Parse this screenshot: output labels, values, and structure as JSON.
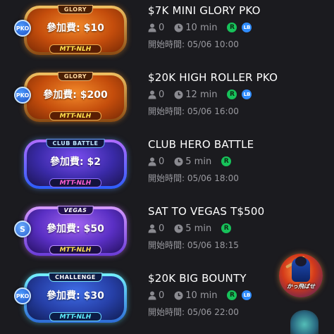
{
  "tournaments": [
    {
      "style": "orange",
      "tag": "GLORY",
      "badge": "PKO",
      "fee": "參加費: $10",
      "game": "MTT-NLH",
      "title": "$7K MINI GLORY PKO",
      "players": "0",
      "duration": "10 min",
      "chips": [
        "R",
        "LB"
      ],
      "start": "開始時間: 05/06 10:00"
    },
    {
      "style": "orange",
      "tag": "GLORY",
      "badge": "PKO",
      "fee": "參加費: $200",
      "game": "MTT-NLH",
      "title": "$20K HIGH ROLLER PKO",
      "players": "0",
      "duration": "12 min",
      "chips": [
        "R",
        "LB"
      ],
      "start": "開始時間: 05/06 16:00"
    },
    {
      "style": "blue",
      "tag": "CLUB BATTLE",
      "badge": "",
      "fee": "參加費: $2",
      "game": "MTT-NLH",
      "title": "CLUB HERO BATTLE",
      "players": "0",
      "duration": "5 min",
      "chips": [
        "R"
      ],
      "start": "開始時間: 05/06 18:00"
    },
    {
      "style": "purple",
      "tag": "VEGAS",
      "badge": "S",
      "fee": "參加費: $50",
      "game": "MTT-NLH",
      "title": "SAT TO VEGAS T$500",
      "players": "0",
      "duration": "5 min",
      "chips": [
        "R"
      ],
      "start": "開始時間: 05/06 18:15"
    },
    {
      "style": "teal",
      "tag": "CHALLENGE",
      "badge": "PKO",
      "fee": "參加費: $30",
      "game": "MTT-NLH",
      "title": "$20K BIG BOUNTY",
      "players": "0",
      "duration": "10 min",
      "chips": [
        "R",
        "LB"
      ],
      "start": "開始時間: 05/06 22:00"
    }
  ],
  "promo": {
    "label": "かっ飛ばせ"
  },
  "icons": {
    "players": "person-icon",
    "duration": "clock-icon"
  },
  "colors": {
    "background": "#1b1b1f",
    "muted_text": "#9a9aa0",
    "chip_r": "#17c25a",
    "chip_lb": "#2f8cff"
  }
}
